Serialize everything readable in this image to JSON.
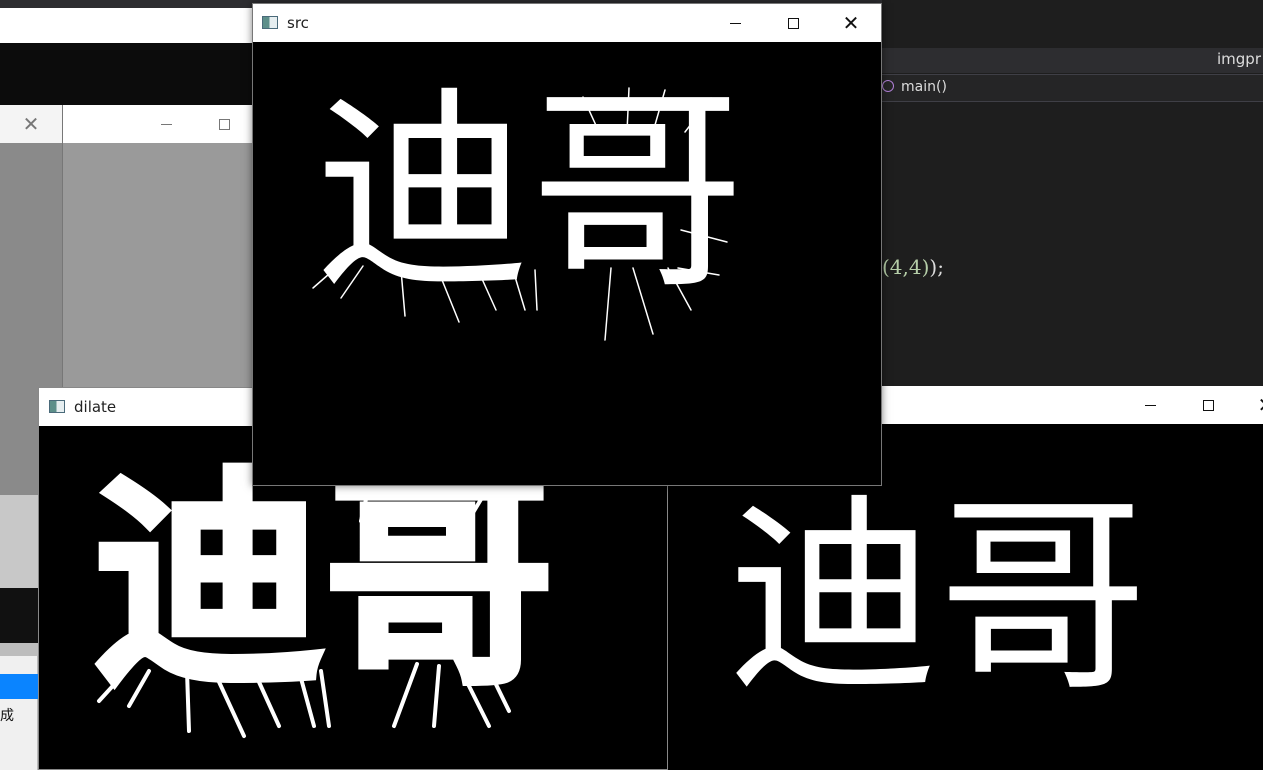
{
  "ide": {
    "top_text": "",
    "file_label": "imgpr",
    "nav_function": "main()",
    "code_line_args": "(4,4)",
    "code_line_end": ");"
  },
  "left_status_text": "成",
  "windows": {
    "src": {
      "title": "src"
    },
    "dilate": {
      "title": "dilate"
    },
    "erode": {
      "title": ""
    }
  },
  "image_text": {
    "main_chars": "迪哥"
  },
  "icons": {
    "minimize": "minimize-icon",
    "maximize": "maximize-icon",
    "close": "close-icon",
    "app": "opencv-window-icon"
  }
}
